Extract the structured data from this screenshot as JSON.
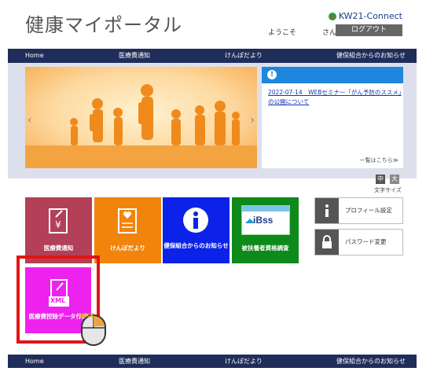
{
  "header": {
    "site_title": "健康マイポータル",
    "brand": "KW21-Connect",
    "welcome": "ようこそ",
    "san": "さん",
    "logout_label": "ログアウト"
  },
  "nav": {
    "items": [
      "Home",
      "医療費通知",
      "けんぽだより",
      "健保組合からのお知らせ"
    ]
  },
  "notice": {
    "link_text": "2022-07-14　WEBセミナー「がん予防のススメ」の公開について",
    "more_label": "一覧はこちら≫"
  },
  "font_size": {
    "medium_label": "中",
    "large_label": "大",
    "caption": "文字サイズ"
  },
  "tiles": [
    {
      "label": "医療費通知",
      "color": "#b34058"
    },
    {
      "label": "けんぽだより",
      "color": "#f2840c"
    },
    {
      "label": "健保組合からのお知らせ",
      "color": "#0d22e8"
    },
    {
      "label": "被扶養者資格調査",
      "color": "#0d8a1a",
      "logo_text": "iBss"
    }
  ],
  "side_buttons": {
    "profile_label": "プロフィール設定",
    "password_label": "パスワード変更"
  },
  "xml_tile": {
    "label": "医療費控除データ作成",
    "icon_text": "XML",
    "cursor_badge": "CLICK",
    "color": "#ee22ee"
  },
  "colors": {
    "nav": "#1f2d5a",
    "notice_header": "#1e86dc",
    "highlight_frame": "#e21414"
  }
}
